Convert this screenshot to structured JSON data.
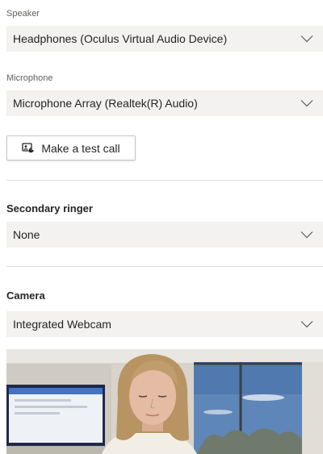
{
  "speaker": {
    "label": "Speaker",
    "selected": "Headphones (Oculus Virtual Audio Device)"
  },
  "microphone": {
    "label": "Microphone",
    "selected": "Microphone Array (Realtek(R) Audio)"
  },
  "test_call": {
    "label": "Make a test call",
    "icon": "call-test-icon"
  },
  "secondary_ringer": {
    "heading": "Secondary ringer",
    "selected": "None"
  },
  "camera": {
    "heading": "Camera",
    "selected": "Integrated Webcam"
  },
  "colors": {
    "dropdown_bg": "#f3f2f1",
    "text": "#252423",
    "label": "#605e5c",
    "divider": "#e1dfdd"
  }
}
